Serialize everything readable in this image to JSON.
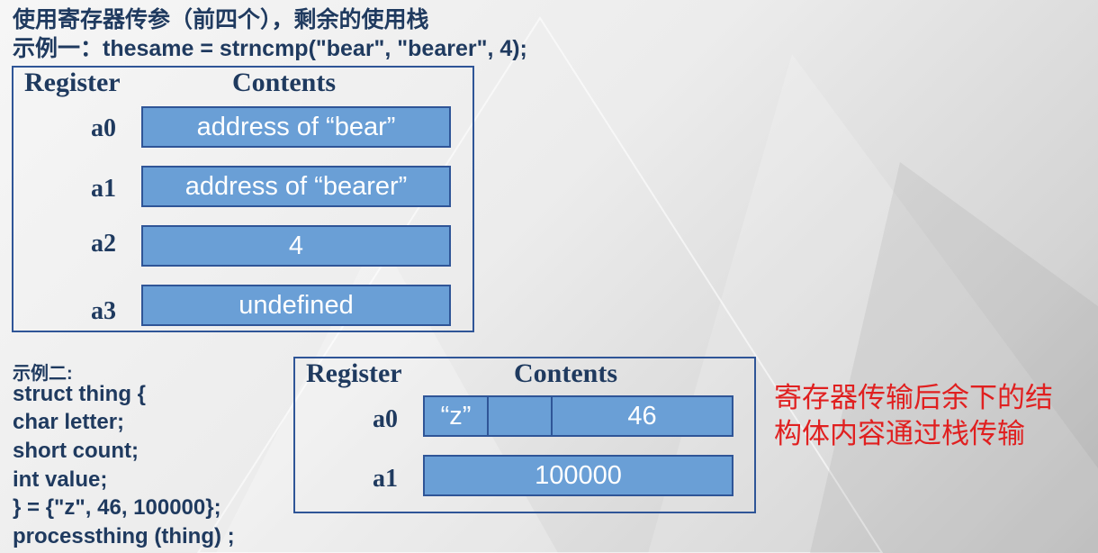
{
  "heading": {
    "line1": "使用寄存器传参（前四个），剩余的使用栈",
    "line2": "示例一：thesame = strncmp(\"bear\", \"bearer\", 4);"
  },
  "example1": {
    "header_register": "Register",
    "header_contents": "Contents",
    "rows": [
      {
        "reg": "a0",
        "value": "address of “bear”"
      },
      {
        "reg": "a1",
        "value": "address of “bearer”"
      },
      {
        "reg": "a2",
        "value": "4"
      },
      {
        "reg": "a3",
        "value": "undefined"
      }
    ]
  },
  "example2": {
    "code_lines": [
      "示例二:",
      "struct thing {",
      "char letter;",
      "short count;",
      "int value;",
      "} = {\"z\", 46, 100000};",
      "processthing (thing) ;"
    ],
    "header_register": "Register",
    "header_contents": "Contents",
    "a0_reg": "a0",
    "a0_letter": "“z”",
    "a0_padding": "",
    "a0_count": "46",
    "a1_reg": "a1",
    "a1_value": "100000"
  },
  "note": {
    "line1": "寄存器传输后余下的结",
    "line2": "构体内容通过栈传输"
  },
  "colors": {
    "title": "#1f3a5f",
    "border": "#2f5597",
    "cell_fill": "#6a9fd6",
    "note": "#e02020"
  }
}
